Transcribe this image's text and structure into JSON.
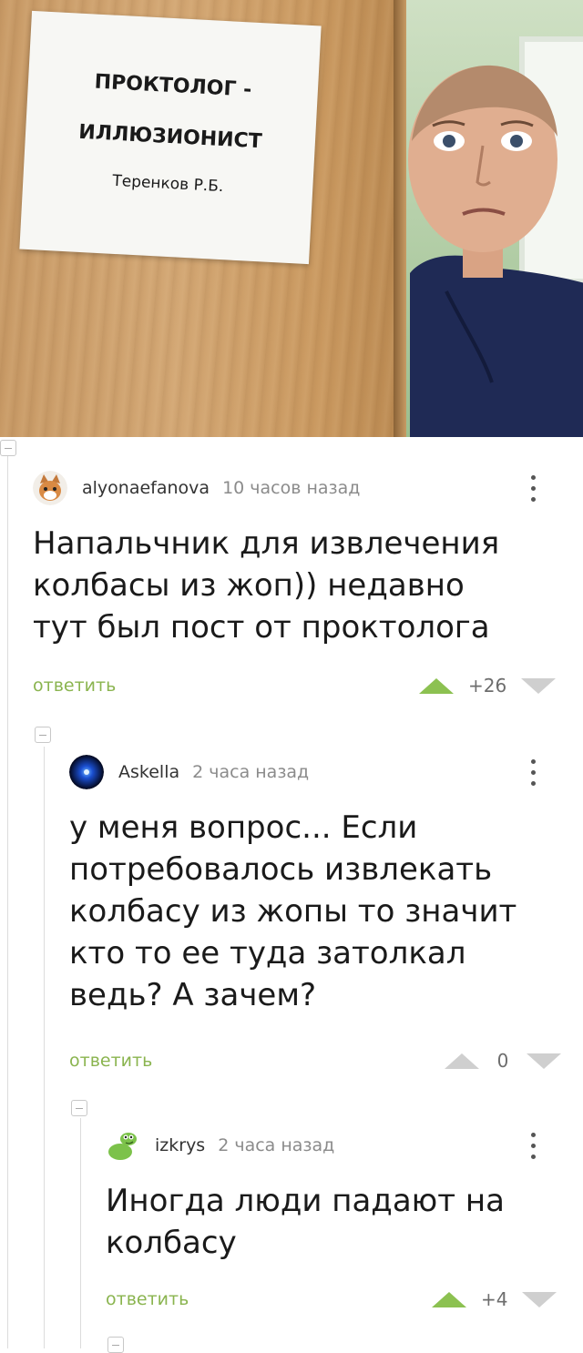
{
  "post_image": {
    "sign_line1": "ПРОКТОЛОГ -",
    "sign_line2": "ИЛЛЮЗИОНИСТ",
    "sign_line3": "Теренков Р.Б."
  },
  "comments": [
    {
      "author": "alyonaefanova",
      "time": "10 часов назад",
      "text_lines": [
        "Напальчник для извлечения",
        "колбасы из жоп)) недавно",
        "тут был пост от проктолога"
      ],
      "reply_label": "ответить",
      "score": "+26",
      "avatar_icon": "cat-avatar-icon"
    },
    {
      "author": "Askella",
      "time": "2 часа назад",
      "text_lines": [
        "у меня вопрос... Если",
        "потребовалось извлекать",
        "колбасу из жопы то значит",
        "кто то ее туда затолкал",
        "ведь? А зачем?"
      ],
      "reply_label": "ответить",
      "score": "0",
      "avatar_icon": "blue-orb-avatar-icon"
    },
    {
      "author": "izkrys",
      "time": "2 часа назад",
      "text_lines": [
        "Иногда люди падают на",
        "колбасу"
      ],
      "reply_label": "ответить",
      "score": "+4",
      "avatar_icon": "green-creature-avatar-icon"
    }
  ],
  "colors": {
    "accent_green": "#8ab44f",
    "upvote_green": "#8cc151",
    "vote_grey": "#cfcfcf"
  }
}
